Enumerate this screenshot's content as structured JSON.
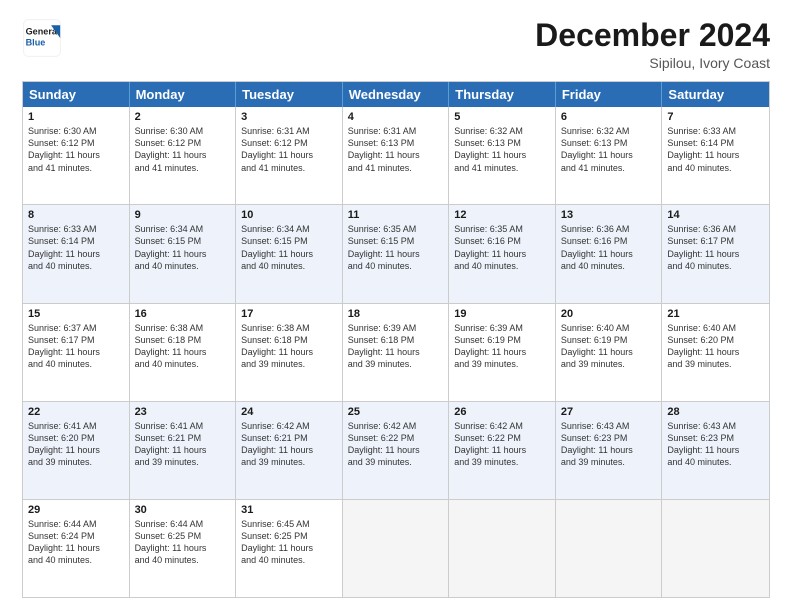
{
  "header": {
    "logo_general": "General",
    "logo_blue": "Blue",
    "month_title": "December 2024",
    "location": "Sipilou, Ivory Coast"
  },
  "days_of_week": [
    "Sunday",
    "Monday",
    "Tuesday",
    "Wednesday",
    "Thursday",
    "Friday",
    "Saturday"
  ],
  "weeks": [
    [
      {
        "day": "1",
        "sunrise": "6:30 AM",
        "sunset": "6:12 PM",
        "daylight": "11 hours and 41 minutes."
      },
      {
        "day": "2",
        "sunrise": "6:30 AM",
        "sunset": "6:12 PM",
        "daylight": "11 hours and 41 minutes."
      },
      {
        "day": "3",
        "sunrise": "6:31 AM",
        "sunset": "6:12 PM",
        "daylight": "11 hours and 41 minutes."
      },
      {
        "day": "4",
        "sunrise": "6:31 AM",
        "sunset": "6:13 PM",
        "daylight": "11 hours and 41 minutes."
      },
      {
        "day": "5",
        "sunrise": "6:32 AM",
        "sunset": "6:13 PM",
        "daylight": "11 hours and 41 minutes."
      },
      {
        "day": "6",
        "sunrise": "6:32 AM",
        "sunset": "6:13 PM",
        "daylight": "11 hours and 41 minutes."
      },
      {
        "day": "7",
        "sunrise": "6:33 AM",
        "sunset": "6:14 PM",
        "daylight": "11 hours and 40 minutes."
      }
    ],
    [
      {
        "day": "8",
        "sunrise": "6:33 AM",
        "sunset": "6:14 PM",
        "daylight": "11 hours and 40 minutes."
      },
      {
        "day": "9",
        "sunrise": "6:34 AM",
        "sunset": "6:15 PM",
        "daylight": "11 hours and 40 minutes."
      },
      {
        "day": "10",
        "sunrise": "6:34 AM",
        "sunset": "6:15 PM",
        "daylight": "11 hours and 40 minutes."
      },
      {
        "day": "11",
        "sunrise": "6:35 AM",
        "sunset": "6:15 PM",
        "daylight": "11 hours and 40 minutes."
      },
      {
        "day": "12",
        "sunrise": "6:35 AM",
        "sunset": "6:16 PM",
        "daylight": "11 hours and 40 minutes."
      },
      {
        "day": "13",
        "sunrise": "6:36 AM",
        "sunset": "6:16 PM",
        "daylight": "11 hours and 40 minutes."
      },
      {
        "day": "14",
        "sunrise": "6:36 AM",
        "sunset": "6:17 PM",
        "daylight": "11 hours and 40 minutes."
      }
    ],
    [
      {
        "day": "15",
        "sunrise": "6:37 AM",
        "sunset": "6:17 PM",
        "daylight": "11 hours and 40 minutes."
      },
      {
        "day": "16",
        "sunrise": "6:38 AM",
        "sunset": "6:18 PM",
        "daylight": "11 hours and 40 minutes."
      },
      {
        "day": "17",
        "sunrise": "6:38 AM",
        "sunset": "6:18 PM",
        "daylight": "11 hours and 39 minutes."
      },
      {
        "day": "18",
        "sunrise": "6:39 AM",
        "sunset": "6:18 PM",
        "daylight": "11 hours and 39 minutes."
      },
      {
        "day": "19",
        "sunrise": "6:39 AM",
        "sunset": "6:19 PM",
        "daylight": "11 hours and 39 minutes."
      },
      {
        "day": "20",
        "sunrise": "6:40 AM",
        "sunset": "6:19 PM",
        "daylight": "11 hours and 39 minutes."
      },
      {
        "day": "21",
        "sunrise": "6:40 AM",
        "sunset": "6:20 PM",
        "daylight": "11 hours and 39 minutes."
      }
    ],
    [
      {
        "day": "22",
        "sunrise": "6:41 AM",
        "sunset": "6:20 PM",
        "daylight": "11 hours and 39 minutes."
      },
      {
        "day": "23",
        "sunrise": "6:41 AM",
        "sunset": "6:21 PM",
        "daylight": "11 hours and 39 minutes."
      },
      {
        "day": "24",
        "sunrise": "6:42 AM",
        "sunset": "6:21 PM",
        "daylight": "11 hours and 39 minutes."
      },
      {
        "day": "25",
        "sunrise": "6:42 AM",
        "sunset": "6:22 PM",
        "daylight": "11 hours and 39 minutes."
      },
      {
        "day": "26",
        "sunrise": "6:42 AM",
        "sunset": "6:22 PM",
        "daylight": "11 hours and 39 minutes."
      },
      {
        "day": "27",
        "sunrise": "6:43 AM",
        "sunset": "6:23 PM",
        "daylight": "11 hours and 39 minutes."
      },
      {
        "day": "28",
        "sunrise": "6:43 AM",
        "sunset": "6:23 PM",
        "daylight": "11 hours and 40 minutes."
      }
    ],
    [
      {
        "day": "29",
        "sunrise": "6:44 AM",
        "sunset": "6:24 PM",
        "daylight": "11 hours and 40 minutes."
      },
      {
        "day": "30",
        "sunrise": "6:44 AM",
        "sunset": "6:25 PM",
        "daylight": "11 hours and 40 minutes."
      },
      {
        "day": "31",
        "sunrise": "6:45 AM",
        "sunset": "6:25 PM",
        "daylight": "11 hours and 40 minutes."
      },
      null,
      null,
      null,
      null
    ]
  ],
  "labels": {
    "sunrise": "Sunrise:",
    "sunset": "Sunset:",
    "daylight": "Daylight:"
  }
}
